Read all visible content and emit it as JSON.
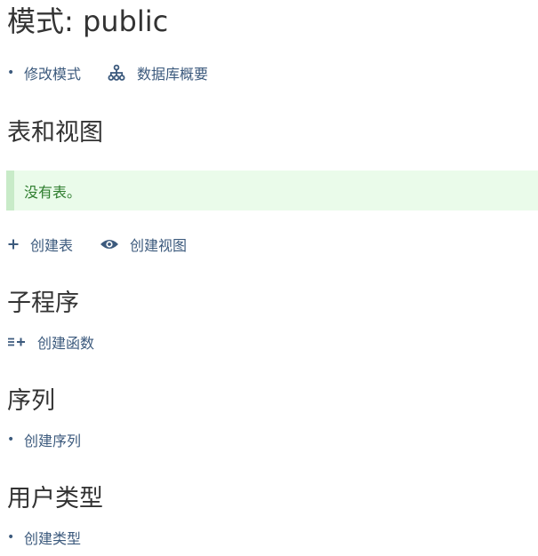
{
  "header": {
    "title": "模式: public"
  },
  "schema_links": {
    "edit_label": "修改模式",
    "overview_label": "数据库概要"
  },
  "tables": {
    "heading": "表和视图",
    "empty_message": "没有表。",
    "create_table_label": "创建表",
    "create_view_label": "创建视图"
  },
  "routines": {
    "heading": "子程序",
    "create_function_label": "创建函数"
  },
  "sequences": {
    "heading": "序列",
    "create_sequence_label": "创建序列"
  },
  "user_types": {
    "heading": "用户类型",
    "create_type_label": "创建类型"
  },
  "icons": {
    "bullet": "bullet-dot",
    "overview": "sitemap-icon",
    "create_table": "plus-icon",
    "create_view": "eye-icon",
    "create_function": "list-add-icon"
  },
  "colors": {
    "link": "#3c5a7d",
    "heading": "#333333",
    "notice_bg": "#eafbea",
    "notice_border": "#c8ebc8",
    "notice_text": "#2e7d2e"
  }
}
